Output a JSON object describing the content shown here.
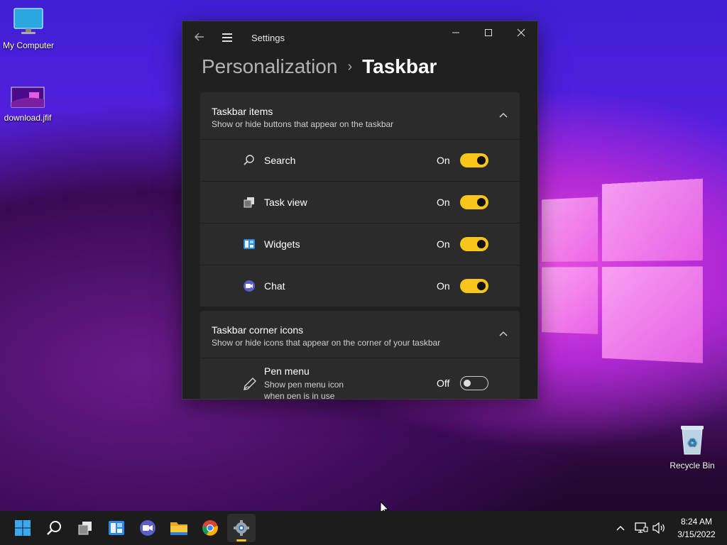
{
  "desktop": {
    "icons": [
      {
        "label": "My Computer"
      },
      {
        "label": "download.jfif"
      },
      {
        "label": "Recycle Bin"
      }
    ]
  },
  "window": {
    "title": "Settings",
    "breadcrumb": {
      "parent": "Personalization",
      "separator": "›",
      "current": "Taskbar"
    },
    "sections": [
      {
        "heading": "Taskbar items",
        "description": "Show or hide buttons that appear on the taskbar",
        "items": [
          {
            "label": "Search",
            "state": "On",
            "icon": "search-icon"
          },
          {
            "label": "Task view",
            "state": "On",
            "icon": "task-view-icon"
          },
          {
            "label": "Widgets",
            "state": "On",
            "icon": "widgets-icon"
          },
          {
            "label": "Chat",
            "state": "On",
            "icon": "chat-icon"
          }
        ]
      },
      {
        "heading": "Taskbar corner icons",
        "description": "Show or hide icons that appear on the corner of your taskbar",
        "items": [
          {
            "label": "Pen menu",
            "sublabel_1": "Show pen menu icon",
            "sublabel_2": "when pen is in use",
            "state": "Off",
            "icon": "pen-icon"
          }
        ]
      }
    ]
  },
  "taskbar": {
    "apps": [
      "start-icon",
      "search-icon",
      "task-view-icon",
      "widgets-icon",
      "chat-icon",
      "file-explorer-icon",
      "chrome-icon",
      "settings-icon"
    ],
    "clock": {
      "time": "8:24 AM",
      "date": "3/15/2022"
    }
  },
  "colors": {
    "accent": "#f7c51b",
    "window_bg": "#202020",
    "card_bg": "#2b2b2b",
    "taskbar_bg": "#1c1c1c"
  }
}
